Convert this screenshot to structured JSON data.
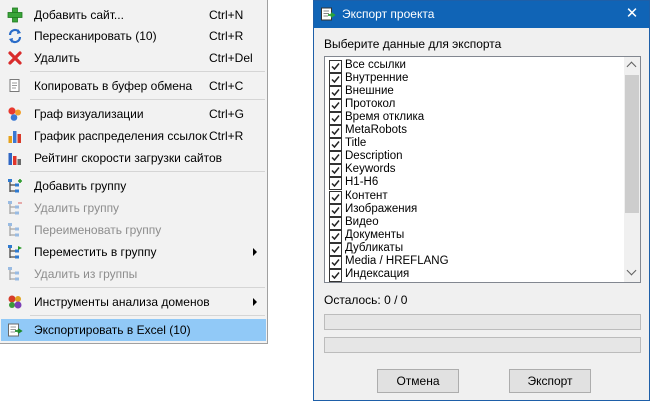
{
  "menu": {
    "items": [
      {
        "label": "Добавить сайт...",
        "shortcut": "Ctrl+N",
        "icon": "plus-icon",
        "disabled": false
      },
      {
        "label": "Пересканировать (10)",
        "shortcut": "Ctrl+R",
        "icon": "refresh-icon",
        "disabled": false
      },
      {
        "label": "Удалить",
        "shortcut": "Ctrl+Del",
        "icon": "delete-x-icon",
        "disabled": false
      },
      {
        "label": "Копировать в буфер обмена",
        "shortcut": "Ctrl+C",
        "icon": "copy-icon",
        "disabled": false
      },
      {
        "label": "Граф визуализации",
        "shortcut": "Ctrl+G",
        "icon": "graph-icon",
        "disabled": false
      },
      {
        "label": "График распределения ссылок",
        "shortcut": "Ctrl+R",
        "icon": "bar-chart-icon",
        "disabled": false
      },
      {
        "label": "Рейтинг скорости загрузки сайтов",
        "shortcut": "",
        "icon": "speed-rating-icon",
        "disabled": false
      },
      {
        "label": "Добавить группу",
        "shortcut": "",
        "icon": "add-group-icon",
        "disabled": false
      },
      {
        "label": "Удалить группу",
        "shortcut": "",
        "icon": "remove-group-icon",
        "disabled": true
      },
      {
        "label": "Переименовать группу",
        "shortcut": "",
        "icon": "rename-group-icon",
        "disabled": true
      },
      {
        "label": "Переместить в группу",
        "shortcut": "",
        "icon": "move-group-icon",
        "disabled": false,
        "submenu": true
      },
      {
        "label": "Удалить из группы",
        "shortcut": "",
        "icon": "remove-from-group-icon",
        "disabled": true
      },
      {
        "label": "Инструменты анализа доменов",
        "shortcut": "",
        "icon": "tools-icon",
        "disabled": false,
        "submenu": true
      },
      {
        "label": "Экспортировать в Excel (10)",
        "shortcut": "",
        "icon": "export-excel-icon",
        "disabled": false,
        "highlighted": true
      }
    ]
  },
  "dialog": {
    "title": "Экспорт проекта",
    "prompt": "Выберите данные для экспорта",
    "options": [
      {
        "label": "Все ссылки",
        "checked": true
      },
      {
        "label": "Внутренние",
        "checked": true
      },
      {
        "label": "Внешние",
        "checked": true
      },
      {
        "label": "Протокол",
        "checked": true
      },
      {
        "label": "Время отклика",
        "checked": true
      },
      {
        "label": "MetaRobots",
        "checked": true
      },
      {
        "label": "Title",
        "checked": true
      },
      {
        "label": "Description",
        "checked": true
      },
      {
        "label": "Keywords",
        "checked": true
      },
      {
        "label": "H1-H6",
        "checked": true
      },
      {
        "label": "Контент",
        "checked": true
      },
      {
        "label": "Изображения",
        "checked": true
      },
      {
        "label": "Видео",
        "checked": true
      },
      {
        "label": "Документы",
        "checked": true
      },
      {
        "label": "Дубликаты",
        "checked": true
      },
      {
        "label": "Media / HREFLANG",
        "checked": true
      },
      {
        "label": "Индексация",
        "checked": true
      }
    ],
    "remaining": "Осталось: 0 / 0",
    "progress1": 0,
    "progress2": 0,
    "cancel_label": "Отмена",
    "export_label": "Экспорт"
  },
  "colors": {
    "title_bar": "#1064b6",
    "menu_highlight": "#91c9f7",
    "progress_fill": "#06b025"
  }
}
